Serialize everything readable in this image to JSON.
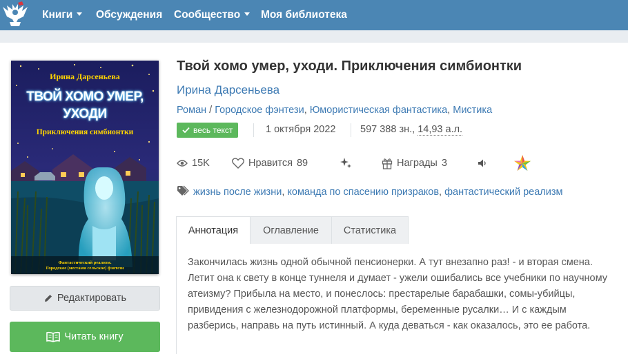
{
  "nav": {
    "items": [
      {
        "label": "Книги",
        "has_caret": true
      },
      {
        "label": "Обсуждения",
        "has_caret": false
      },
      {
        "label": "Сообщество",
        "has_caret": true
      },
      {
        "label": "Моя библиотека",
        "has_caret": false
      }
    ],
    "logo_icon": "eagle-logo-icon"
  },
  "cover": {
    "author": "Ирина Дарсеньева",
    "title_line1": "ТВОЙ ХОМО УМЕР,",
    "title_line2": "УХОДИ",
    "subtitle": "Приключения симбионтки",
    "footer_line1": "Фантастический реализм.",
    "footer_line2": "Городское (местами сельское) фэнтези"
  },
  "book": {
    "title": "Твой хомо умер, уходи. Приключения симбионтки",
    "author": "Ирина Дарсеньева",
    "genres": [
      "Роман",
      "Городское фэнтези",
      "Юмористическая фантастика",
      "Мистика"
    ],
    "genre_separator_first": " / ",
    "genre_separator": ", ",
    "status_badge": "весь текст",
    "date": "1 октября 2022",
    "size_chars": "597 388 зн., ",
    "size_al": "14,93 а.л."
  },
  "stats": {
    "views": "15K",
    "likes_label": "Нравится",
    "likes_count": "89",
    "awards_label": "Награды",
    "awards_count": "3"
  },
  "tags": {
    "items": [
      "жизнь после жизни",
      "команда по спасению призраков",
      "фантастический реализм"
    ],
    "separator": ", "
  },
  "tabs": [
    {
      "label": "Аннотация",
      "active": true
    },
    {
      "label": "Оглавление",
      "active": false
    },
    {
      "label": "Статистика",
      "active": false
    }
  ],
  "annotation": "Закончилась жизнь одной обычной пенсионерки. А тут внезапно раз! - и вторая смена. Летит она к свету в конце туннеля и думает - ужели ошибались все учебники по научному атеизму? Прибыла на место, и понеслось: престарелые барабашки, сомы-убийцы, привидения с железнодорожной платформы, беременные русалки… И с каждым разберись, направь на путь истинный. А куда деваться - как оказалось, это ее работа.",
  "actions": {
    "edit_label": "Редактировать",
    "read_label": "Читать книгу"
  },
  "colors": {
    "nav_bg": "#4b86b4",
    "link": "#3d7ab3",
    "green": "#5cb85c"
  }
}
